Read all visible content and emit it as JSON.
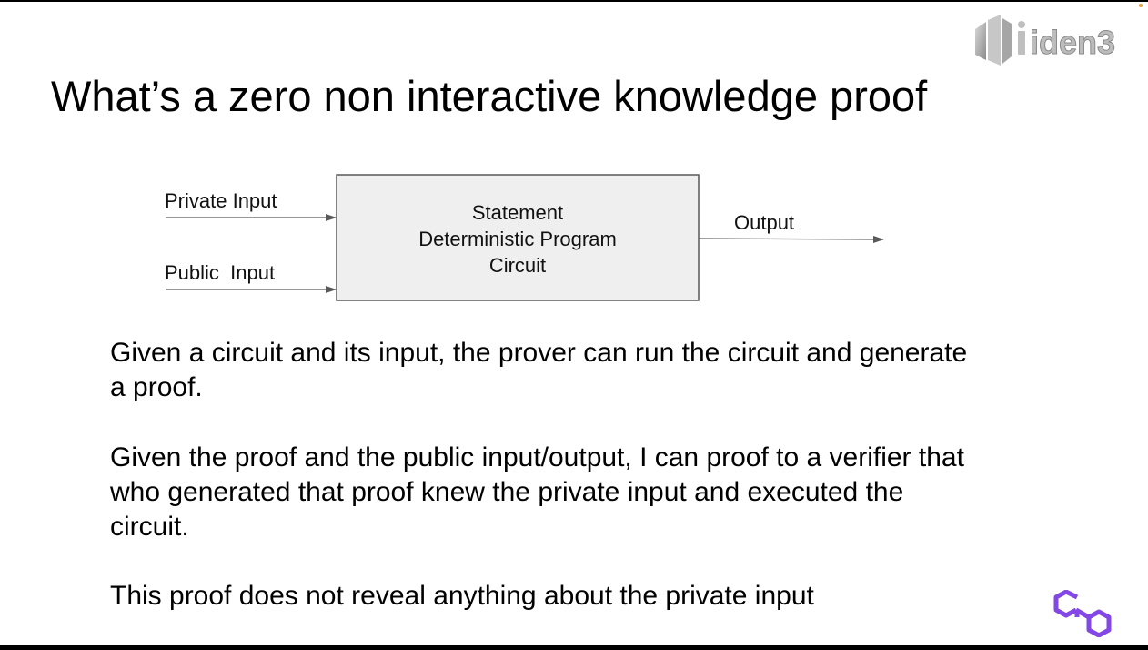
{
  "slide": {
    "title": "What’s a zero non interactive knowledge proof",
    "logo_text": "iden3"
  },
  "diagram": {
    "inputs": [
      "Private Input",
      "Public  Input"
    ],
    "box_lines": [
      "Statement",
      "Deterministic Program",
      "Circuit"
    ],
    "output": "Output",
    "colors": {
      "box_fill": "#efefef",
      "box_stroke": "#595959",
      "arrow": "#595959"
    }
  },
  "paragraphs": [
    "Given a circuit and its input, the prover can run the circuit and generate a proof.",
    "Given the proof and the public input/output, I can proof to a verifier that who generated that proof knew the private input and executed the circuit.",
    "This proof does not reveal anything about the private input"
  ],
  "colors": {
    "polygon_logo": "#8247e5",
    "iden3_logo": "#b7b7b7",
    "accent_dot": "#e8a33a"
  },
  "icons": {
    "iden3": "iden3-logo-icon",
    "polygon": "polygon-logo-icon"
  }
}
